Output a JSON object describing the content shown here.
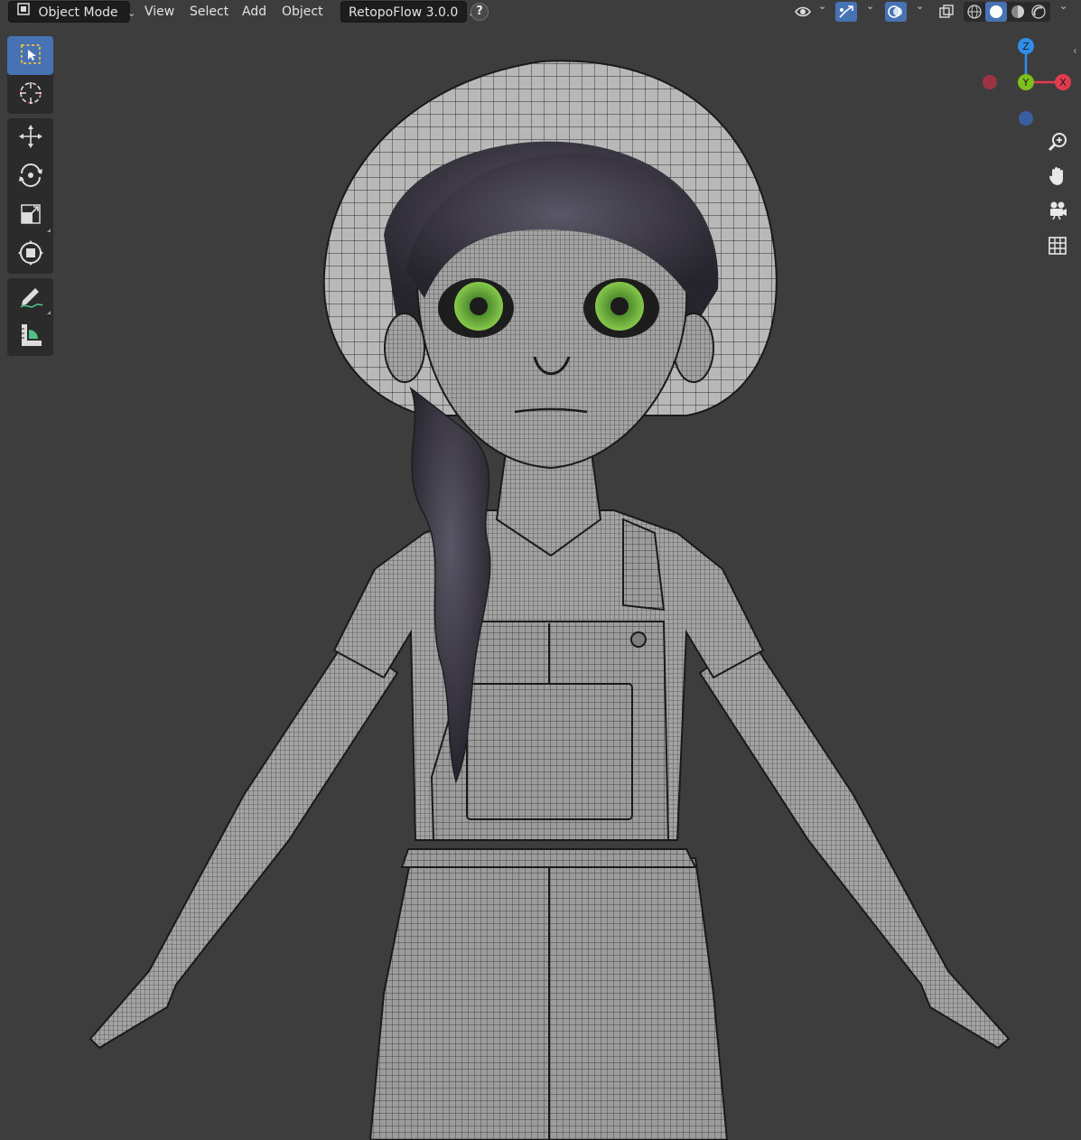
{
  "header": {
    "mode_label": "Object Mode",
    "menu": [
      "View",
      "Select",
      "Add",
      "Object"
    ],
    "addon_label": "RetopoFlow 3.0.0",
    "help_label": "?"
  },
  "toolbar": {
    "tools": [
      "select-box",
      "cursor",
      "move",
      "rotate",
      "scale",
      "transform",
      "annotate",
      "measure"
    ],
    "active_tool": "select-box"
  },
  "gizmo": {
    "axes": [
      "Z",
      "Y",
      "X"
    ],
    "colors": {
      "x": "#e23a4e",
      "y": "#7fbf1c",
      "z": "#2f8fe8",
      "neg_x": "#9d3444",
      "neg_z": "#3a5fa0"
    }
  },
  "nav_buttons": [
    "zoom-icon",
    "hand-icon",
    "camera-icon",
    "grid-icon"
  ],
  "shading": {
    "active": "solid"
  },
  "colors": {
    "accent": "#4772b3",
    "viewport_bg": "#3d3d3d",
    "eye": "#7ac043"
  }
}
